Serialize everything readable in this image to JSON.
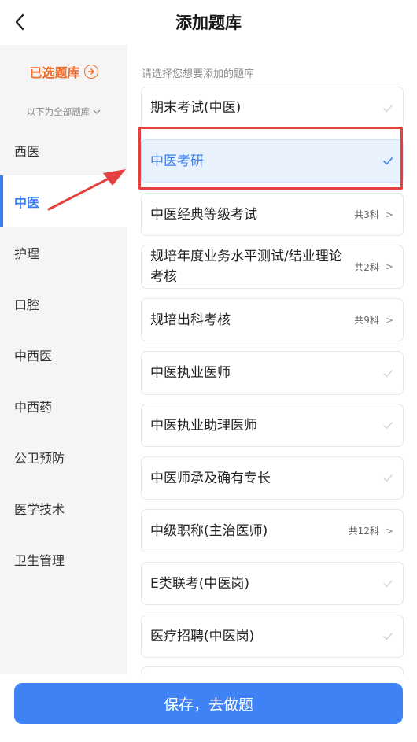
{
  "header": {
    "title": "添加题库"
  },
  "sidebar": {
    "selected_link": "已选题库",
    "all_label": "以下为全部题库",
    "items": [
      {
        "label": "西医"
      },
      {
        "label": "中医",
        "active": true
      },
      {
        "label": "护理"
      },
      {
        "label": "口腔"
      },
      {
        "label": "中西医"
      },
      {
        "label": "中西药"
      },
      {
        "label": "公卫预防"
      },
      {
        "label": "医学技术"
      },
      {
        "label": "卫生管理"
      }
    ]
  },
  "main": {
    "hint": "请选择您想要添加的题库",
    "banks": [
      {
        "name": "期末考试(中医)",
        "count": "",
        "selected": false
      },
      {
        "name": "中医考研",
        "count": "",
        "selected": true
      },
      {
        "name": "中医经典等级考试",
        "count": "共3科"
      },
      {
        "name": "规培年度业务水平测试/结业理论考核",
        "count": "共2科"
      },
      {
        "name": "规培出科考核",
        "count": "共9科"
      },
      {
        "name": "中医执业医师",
        "count": ""
      },
      {
        "name": "中医执业助理医师",
        "count": ""
      },
      {
        "name": "中医师承及确有专长",
        "count": ""
      },
      {
        "name": "中级职称(主治医师)",
        "count": "共12科"
      },
      {
        "name": "E类联考(中医岗)",
        "count": ""
      },
      {
        "name": "医疗招聘(中医岗)",
        "count": ""
      }
    ]
  },
  "footer": {
    "save_label": "保存，去做题"
  },
  "colors": {
    "accent": "#3a7ef0",
    "orange": "#f26b2a",
    "highlight": "#e54040",
    "button": "#3f82f5"
  },
  "icons": {
    "back": "chevron-left-icon",
    "selected_link": "circle-arrow-right-icon",
    "check": "check-icon",
    "expand": "chevron-right-icon"
  }
}
